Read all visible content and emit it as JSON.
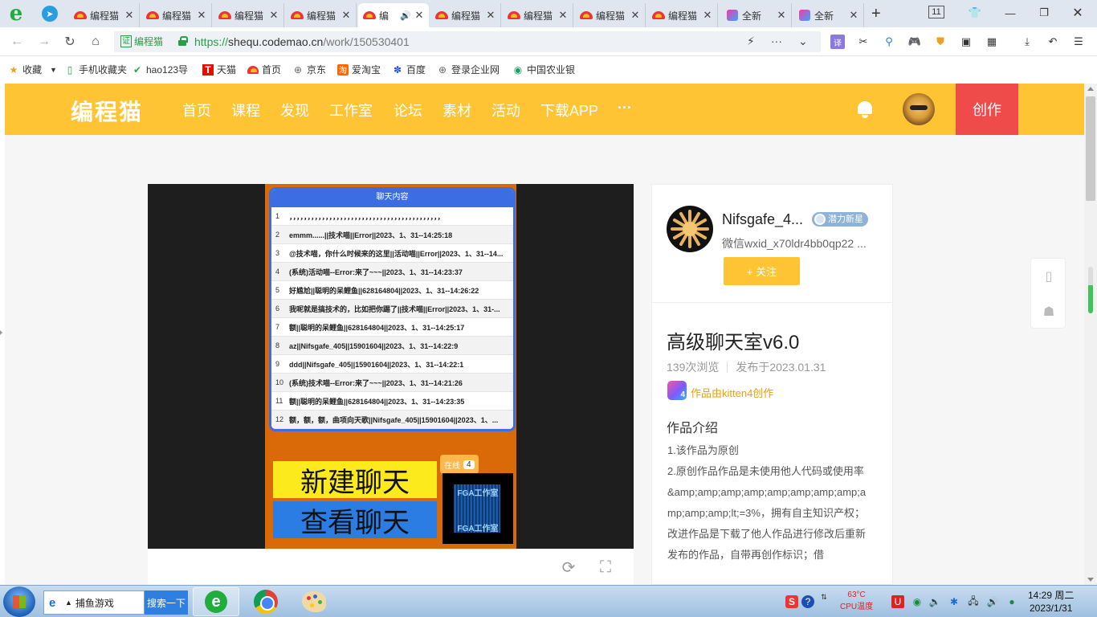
{
  "browser": {
    "tabs": [
      {
        "title": "编程猫",
        "fav": "cat"
      },
      {
        "title": "编程猫",
        "fav": "cat"
      },
      {
        "title": "编程猫",
        "fav": "cat"
      },
      {
        "title": "编程猫",
        "fav": "cat"
      },
      {
        "title": "编",
        "fav": "cat",
        "active": true,
        "audio": "🔊"
      },
      {
        "title": "编程猫",
        "fav": "cat"
      },
      {
        "title": "编程猫",
        "fav": "cat"
      },
      {
        "title": "编程猫",
        "fav": "cat"
      },
      {
        "title": "编程猫",
        "fav": "cat"
      },
      {
        "title": "全新",
        "fav": "k"
      },
      {
        "title": "全新",
        "fav": "k"
      }
    ],
    "tab_count": "11",
    "address": {
      "cert_label": "证",
      "cert_site": "编程猫",
      "protocol": "https://",
      "host": "shequ.codemao.cn",
      "path": "/work/150530401"
    },
    "bookmarks": [
      "收藏",
      "手机收藏夹",
      "hao123导",
      "天猫",
      "首页",
      "京东",
      "爱淘宝",
      "百度",
      "登录企业网",
      "中国农业银"
    ]
  },
  "site": {
    "logo": "编程猫",
    "nav": [
      "首页",
      "课程",
      "发现",
      "工作室",
      "论坛",
      "素材",
      "活动",
      "下载APP",
      "···"
    ],
    "create_label": "创作"
  },
  "player": {
    "chat_title": "聊天内容",
    "rows": [
      {
        "n": "1",
        "text": "，，，，，，，，，，，，，，，，，，，，，，，，，，，，，，，，，，，，，，，，，，"
      },
      {
        "n": "2",
        "text": "emmm......||技术喵||Error||2023、1、31--14:25:18"
      },
      {
        "n": "3",
        "text": "@技术喵，你什么时候来的这里||活动喵||Error||2023、1、31--14..."
      },
      {
        "n": "4",
        "text": "(系统)活动喵--Error:来了~~~||2023、1、31--14:23:37"
      },
      {
        "n": "5",
        "text": "好尴尬||聪明的呆鲤鱼||628164804||2023、1、31--14:26:22"
      },
      {
        "n": "6",
        "text": "我呢就是搞技术的，比如把你踢了||技术喵||Error||2023、1、31-..."
      },
      {
        "n": "7",
        "text": "额||聪明的呆鲤鱼||628164804||2023、1、31--14:25:17"
      },
      {
        "n": "8",
        "text": "az||Nifsgafe_405||15901604||2023、1、31--14:22:9"
      },
      {
        "n": "9",
        "text": "ddd||Nifsgafe_405||15901604||2023、1、31--14:22:1"
      },
      {
        "n": "10",
        "text": "(系统)技术喵--Error:来了~~~||2023、1、31--14:21:26"
      },
      {
        "n": "11",
        "text": "额||聪明的呆鲤鱼||628164804||2023、1、31--14:23:35"
      },
      {
        "n": "12",
        "text": "额，额，额，曲项向天歌||Nifsgafe_405||15901604||2023、1、..."
      }
    ],
    "new_chat": "新建聊天",
    "view_chat": "查看聊天",
    "online_label": "在线",
    "online_count": "4",
    "studio_text": "FGA工作室"
  },
  "author": {
    "name": "Nifsgafe_4...",
    "badge": "潜力新星",
    "bio": "微信wxid_x70ldr4bb0qp22 ...",
    "follow_label": "+ 关注"
  },
  "work": {
    "title": "高级聊天室v6.0",
    "views": "139次浏览",
    "published": "发布于2023.01.31",
    "made_with": "作品由kitten4创作",
    "intro_heading": "作品介绍",
    "intro_text": "1.该作品为原创\n2.原创作品作品是未使用他人代码或使用率\n&amp;amp;amp;amp;amp;amp;amp;amp;amp;amp;amp;lt;=3%，拥有自主知识产权；改进作品是下载了他人作品进行修改后重新发布的作品，自带再创作标识；借"
  },
  "taskbar": {
    "search_value": "捕鱼游戏",
    "search_button": "搜索一下",
    "cpu_temp": "63°C",
    "cpu_label": "CPU温度",
    "time": "14:29 周二",
    "date": "2023/1/31"
  }
}
